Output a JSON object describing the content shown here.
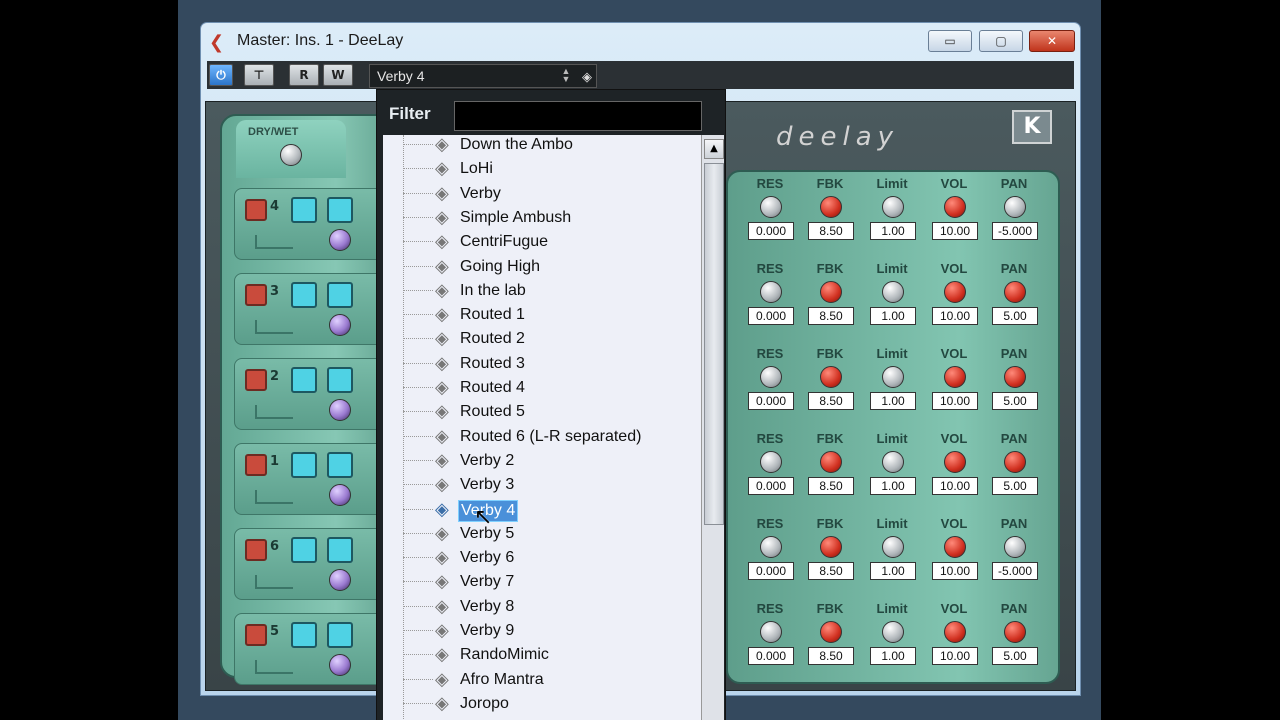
{
  "window": {
    "title": "Master: Ins. 1 - DeeLay",
    "min_glyph": "▭",
    "max_glyph": "▢",
    "close_glyph": "✕"
  },
  "toolbar": {
    "power_glyph": "⏻",
    "bypass_glyph": "⊤",
    "read_label": "R",
    "write_label": "W",
    "preset": "Verby 4"
  },
  "plugin": {
    "dry_wet_label": "DRY/WET",
    "logo": "deelay",
    "brand_glyph": "K",
    "taps": [
      "4",
      "3",
      "2",
      "1",
      "6",
      "5"
    ],
    "columns": [
      "RES",
      "FBK",
      "Limit",
      "VOL",
      "PAN"
    ],
    "bands": [
      {
        "res": "0.000",
        "fbk": "8.50",
        "limit": "1.00",
        "vol": "10.00",
        "pan": "-5.000"
      },
      {
        "res": "0.000",
        "fbk": "8.50",
        "limit": "1.00",
        "vol": "10.00",
        "pan": "5.00"
      },
      {
        "res": "0.000",
        "fbk": "8.50",
        "limit": "1.00",
        "vol": "10.00",
        "pan": "5.00"
      },
      {
        "res": "0.000",
        "fbk": "8.50",
        "limit": "1.00",
        "vol": "10.00",
        "pan": "5.00"
      },
      {
        "res": "0.000",
        "fbk": "8.50",
        "limit": "1.00",
        "vol": "10.00",
        "pan": "-5.000"
      },
      {
        "res": "0.000",
        "fbk": "8.50",
        "limit": "1.00",
        "vol": "10.00",
        "pan": "5.00"
      }
    ]
  },
  "dropdown": {
    "filter_label": "Filter",
    "filter_value": "",
    "items": [
      "Down the Ambo",
      "LoHi",
      "Verby",
      "Simple Ambush",
      "CentriFugue",
      "Going High",
      "In the lab",
      "Routed 1",
      "Routed 2",
      "Routed 3",
      "Routed 4",
      "Routed 5",
      "Routed 6 (L-R separated)",
      "Verby 2",
      "Verby 3",
      "Verby 4",
      "Verby 5",
      "Verby 6",
      "Verby 7",
      "Verby 8",
      "Verby 9",
      "RandoMimic",
      "Afro Mantra",
      "Joropo"
    ],
    "selected_index": 15
  }
}
